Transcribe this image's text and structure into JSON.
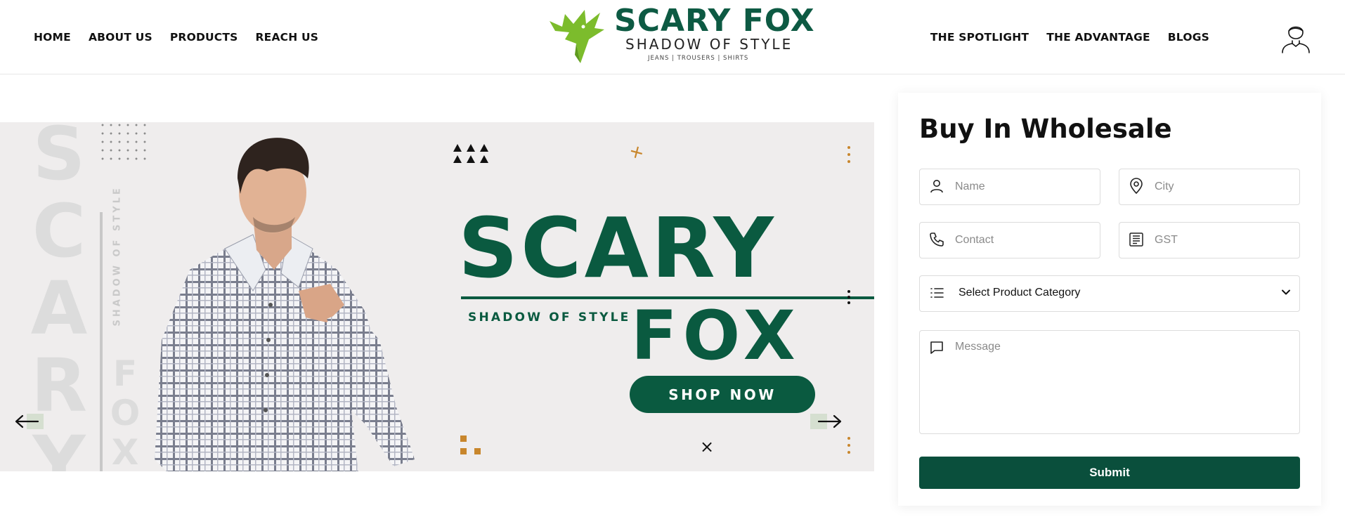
{
  "nav": {
    "left": [
      "HOME",
      "ABOUT US",
      "PRODUCTS",
      "REACH US"
    ],
    "right": [
      "THE SPOTLIGHT",
      "THE ADVANTAGE",
      "BLOGS"
    ]
  },
  "logo": {
    "title": "SCARY FOX",
    "subtitle": "SHADOW OF STYLE",
    "tagline": "JEANS  |  TROUSERS  |  SHIRTS"
  },
  "banner": {
    "bg_word": "SCARY",
    "bg_word_letters": [
      "S",
      "C",
      "A",
      "R",
      "Y"
    ],
    "bg_word2_letters": [
      "F",
      "O",
      "X"
    ],
    "vertical_text": "SHADOW OF STYLE",
    "title_main": "SCARY",
    "title_sub": "SHADOW OF STYLE",
    "title_second": "FOX",
    "cta_label": "SHOP NOW"
  },
  "form": {
    "title": "Buy In Wholesale",
    "name_placeholder": "Name",
    "city_placeholder": "City",
    "contact_placeholder": "Contact",
    "gst_placeholder": "GST",
    "category_selected": "Select Product Category",
    "message_placeholder": "Message",
    "submit_label": "Submit"
  },
  "colors": {
    "brand_green": "#0a5a40",
    "logo_lime": "#7cbc2c",
    "accent_orange": "#c8862c",
    "banner_bg": "#efeded"
  },
  "icons": {
    "user": "user-icon",
    "name": "person-icon",
    "city": "map-pin-icon",
    "contact": "phone-icon",
    "gst": "receipt-icon",
    "category": "list-icon",
    "message": "message-icon",
    "prev": "arrow-left-icon",
    "next": "arrow-right-icon"
  }
}
